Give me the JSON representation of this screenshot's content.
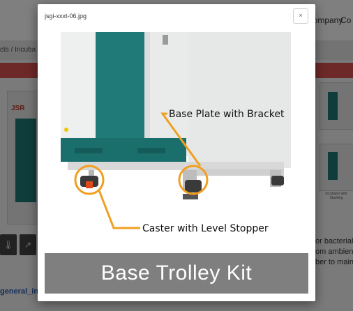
{
  "background": {
    "nav": [
      "Company",
      "Co"
    ],
    "breadcrumb": "cts / Incuba",
    "logo": "JSR",
    "thumb_caption": "Incubator with Stacking",
    "text_lines": [
      "or bacterial,",
      "om ambien",
      "ber to main"
    ],
    "bottom_link": "general_incu"
  },
  "modal": {
    "title": "jsgi-xxxt-06.jpg",
    "close_label": "×",
    "callouts": {
      "top": "Base Plate with Bracket",
      "bottom": "Caster with Level Stopper"
    },
    "banner": "Base Trolley Kit"
  },
  "colors": {
    "accent_teal": "#1f7a78",
    "callout_orange": "#f0a020",
    "banner_gray": "#7f7f7f"
  }
}
